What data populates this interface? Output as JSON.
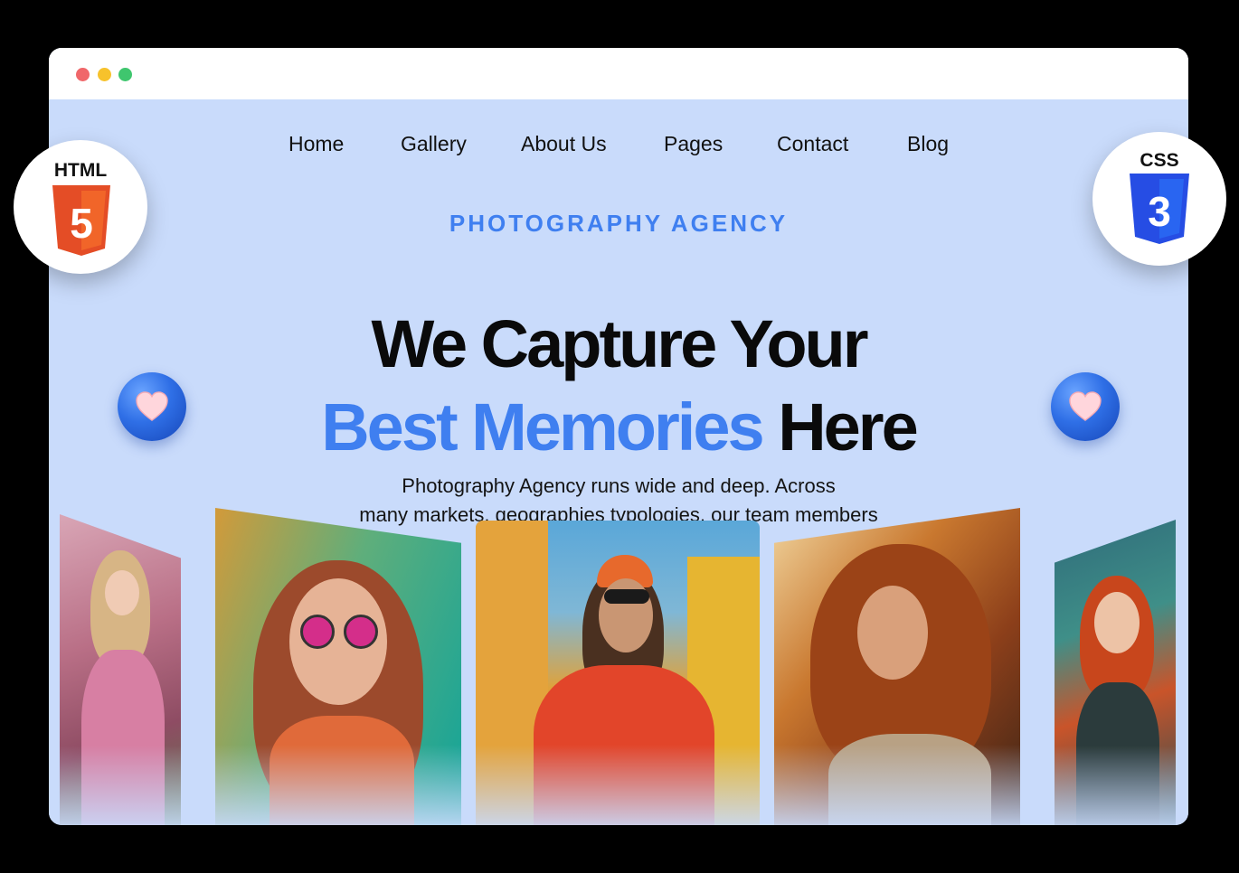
{
  "nav": {
    "items": [
      {
        "label": "Home"
      },
      {
        "label": "Gallery"
      },
      {
        "label": "About Us"
      },
      {
        "label": "Pages"
      },
      {
        "label": "Contact"
      },
      {
        "label": "Blog"
      }
    ]
  },
  "hero": {
    "eyebrow": "PHOTOGRAPHY AGENCY",
    "headline_line1": "We Capture Your",
    "headline_accent": "Best Memories",
    "headline_tail": "Here",
    "description_line1": "Photography Agency runs wide and deep. Across",
    "description_line2": "many markets, geographies typologies, our team members"
  },
  "badges": {
    "html_label": "HTML",
    "html_logo_digit": "5",
    "css_label": "CSS",
    "css_logo_digit": "3"
  },
  "icons": {
    "left_heart": "heart-icon",
    "right_heart": "heart-icon"
  },
  "colors": {
    "page_background": "#c9dbfb",
    "accent_blue": "#3f7ff0",
    "html5_orange": "#e44d26",
    "css3_blue": "#264de4"
  },
  "gallery": {
    "photos": [
      {
        "subject": "woman in pink dress in flower field"
      },
      {
        "subject": "woman with pink round sunglasses"
      },
      {
        "subject": "man in orange jacket and beanie on street"
      },
      {
        "subject": "woman with flowing red hair"
      },
      {
        "subject": "smiling red-haired woman in water"
      }
    ]
  }
}
